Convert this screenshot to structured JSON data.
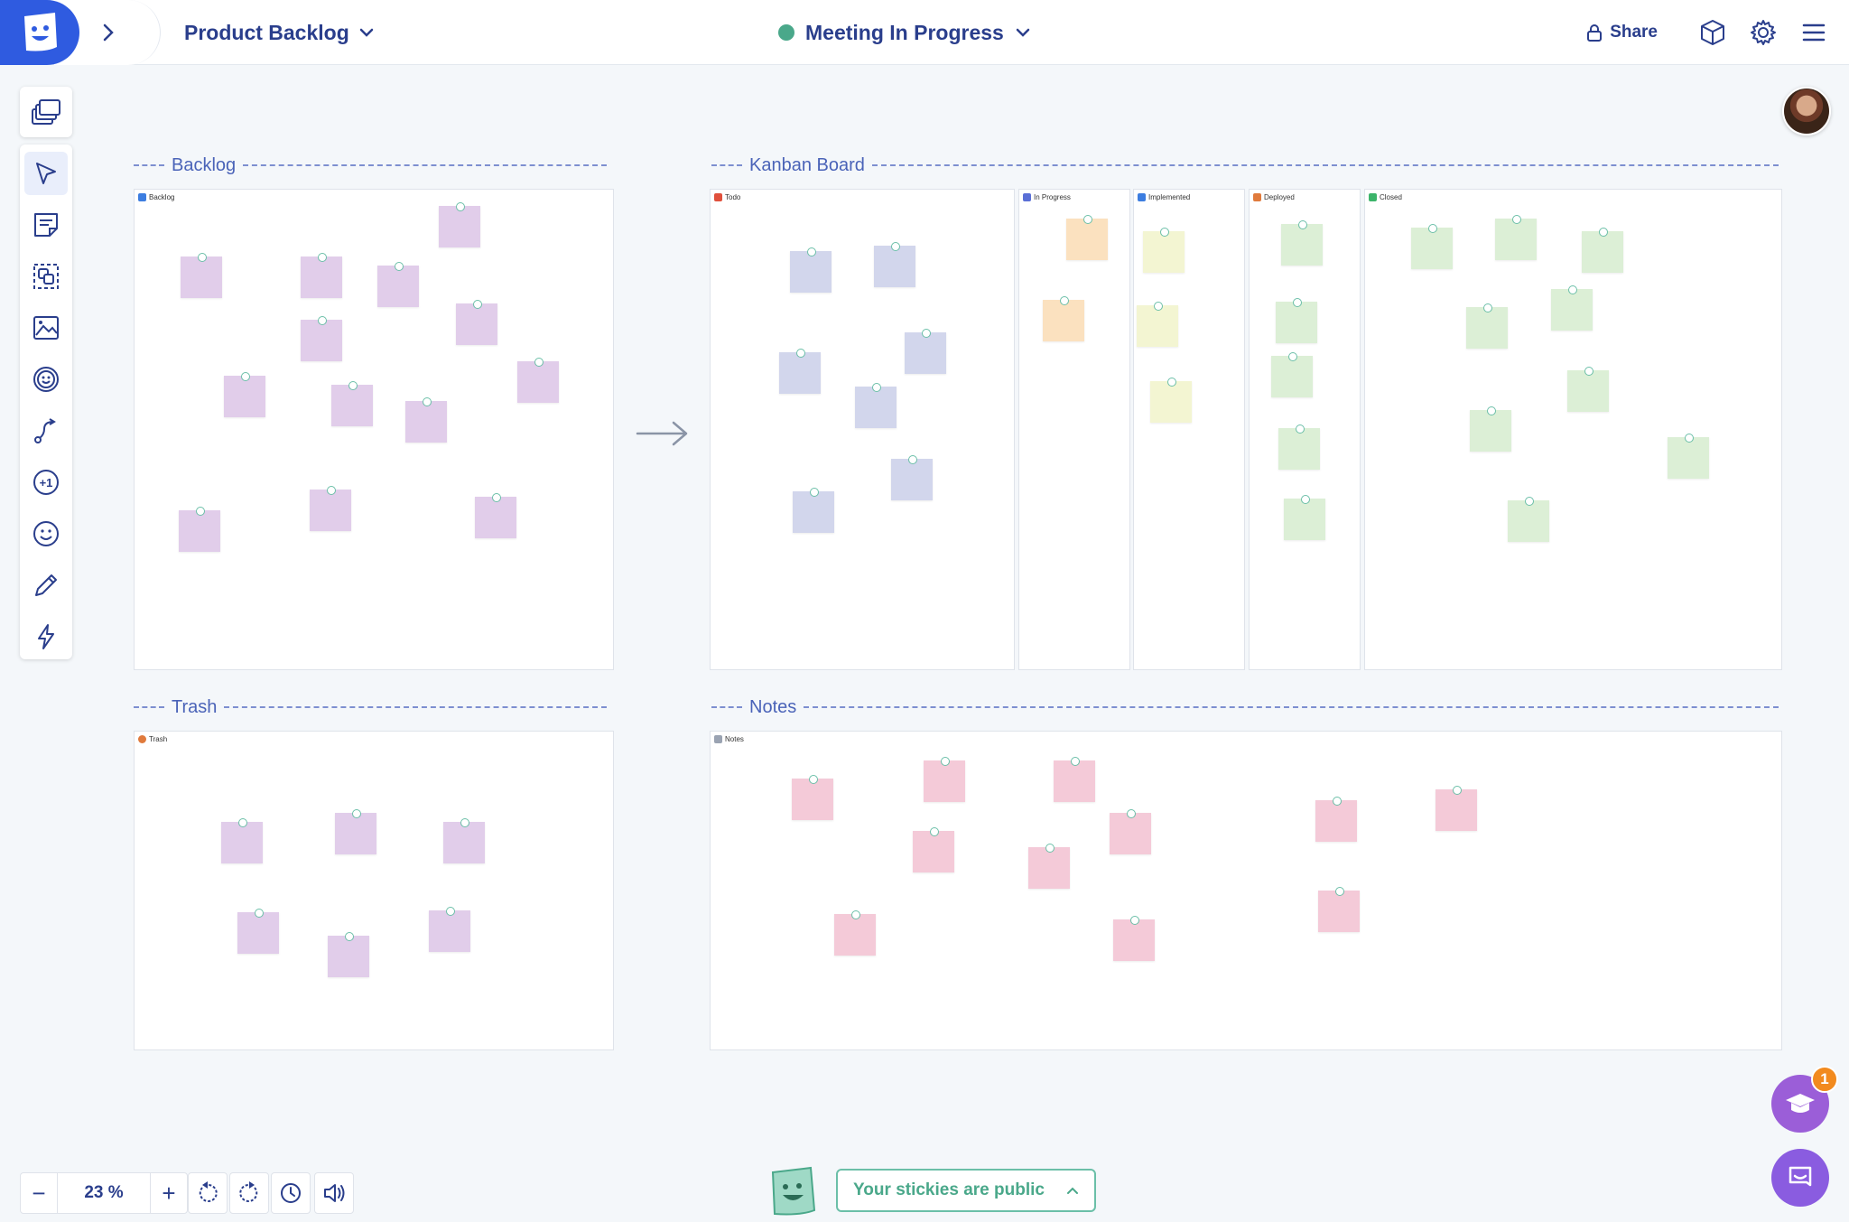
{
  "header": {
    "board_title": "Product Backlog",
    "meeting_status": "Meeting In Progress",
    "share_label": "Share",
    "status_color": "#4aa88a",
    "accent_color": "#2f5be0"
  },
  "toolbar": {
    "tools": [
      "templates-icon",
      "select-icon",
      "sticky-note-icon",
      "frame-icon",
      "image-icon",
      "emoji-sticker-icon",
      "connector-icon",
      "vote-icon",
      "reaction-icon",
      "pen-icon",
      "lightning-icon"
    ]
  },
  "sections": {
    "backlog": {
      "label": "Backlog",
      "frame_title": "Backlog"
    },
    "kanban": {
      "label": "Kanban Board",
      "columns": [
        "Todo",
        "In Progress",
        "Implemented",
        "Deployed",
        "Closed"
      ]
    },
    "trash": {
      "label": "Trash",
      "frame_title": "Trash"
    },
    "notes": {
      "label": "Notes",
      "frame_title": "Notes"
    }
  },
  "zoom": {
    "value": "23 %",
    "minus": "−",
    "plus": "+"
  },
  "footer": {
    "public_notice": "Your stickies are public"
  },
  "learn_badge_count": "1"
}
